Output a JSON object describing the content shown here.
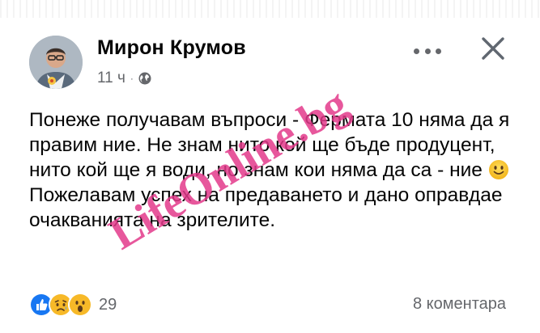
{
  "post": {
    "author": "Мирон Крумов",
    "time": "11 ч",
    "separator": "·",
    "privacy_icon": "globe-icon",
    "text_segments": [
      "Понеже получавам въпроси - Фермата 10 няма да я правим ние. Не знам нито кой ще бъде продуцент, нито кой ще я води, но знам кои няма да са - ние ",
      " Пожелавам успех на предаването и дано оправдае очакванията на зрителите."
    ],
    "inline_emoji": "slightly-smiling-face-icon"
  },
  "watermark": {
    "text": "LifeOnline.bg",
    "color": "#e33a8b"
  },
  "footer": {
    "reactions": [
      "like-icon",
      "sad-icon",
      "wow-icon"
    ],
    "reaction_count": "29",
    "comments": "8 коментара"
  },
  "colors": {
    "text": "#050505",
    "secondary": "#65676b",
    "like": "#1877f2"
  }
}
